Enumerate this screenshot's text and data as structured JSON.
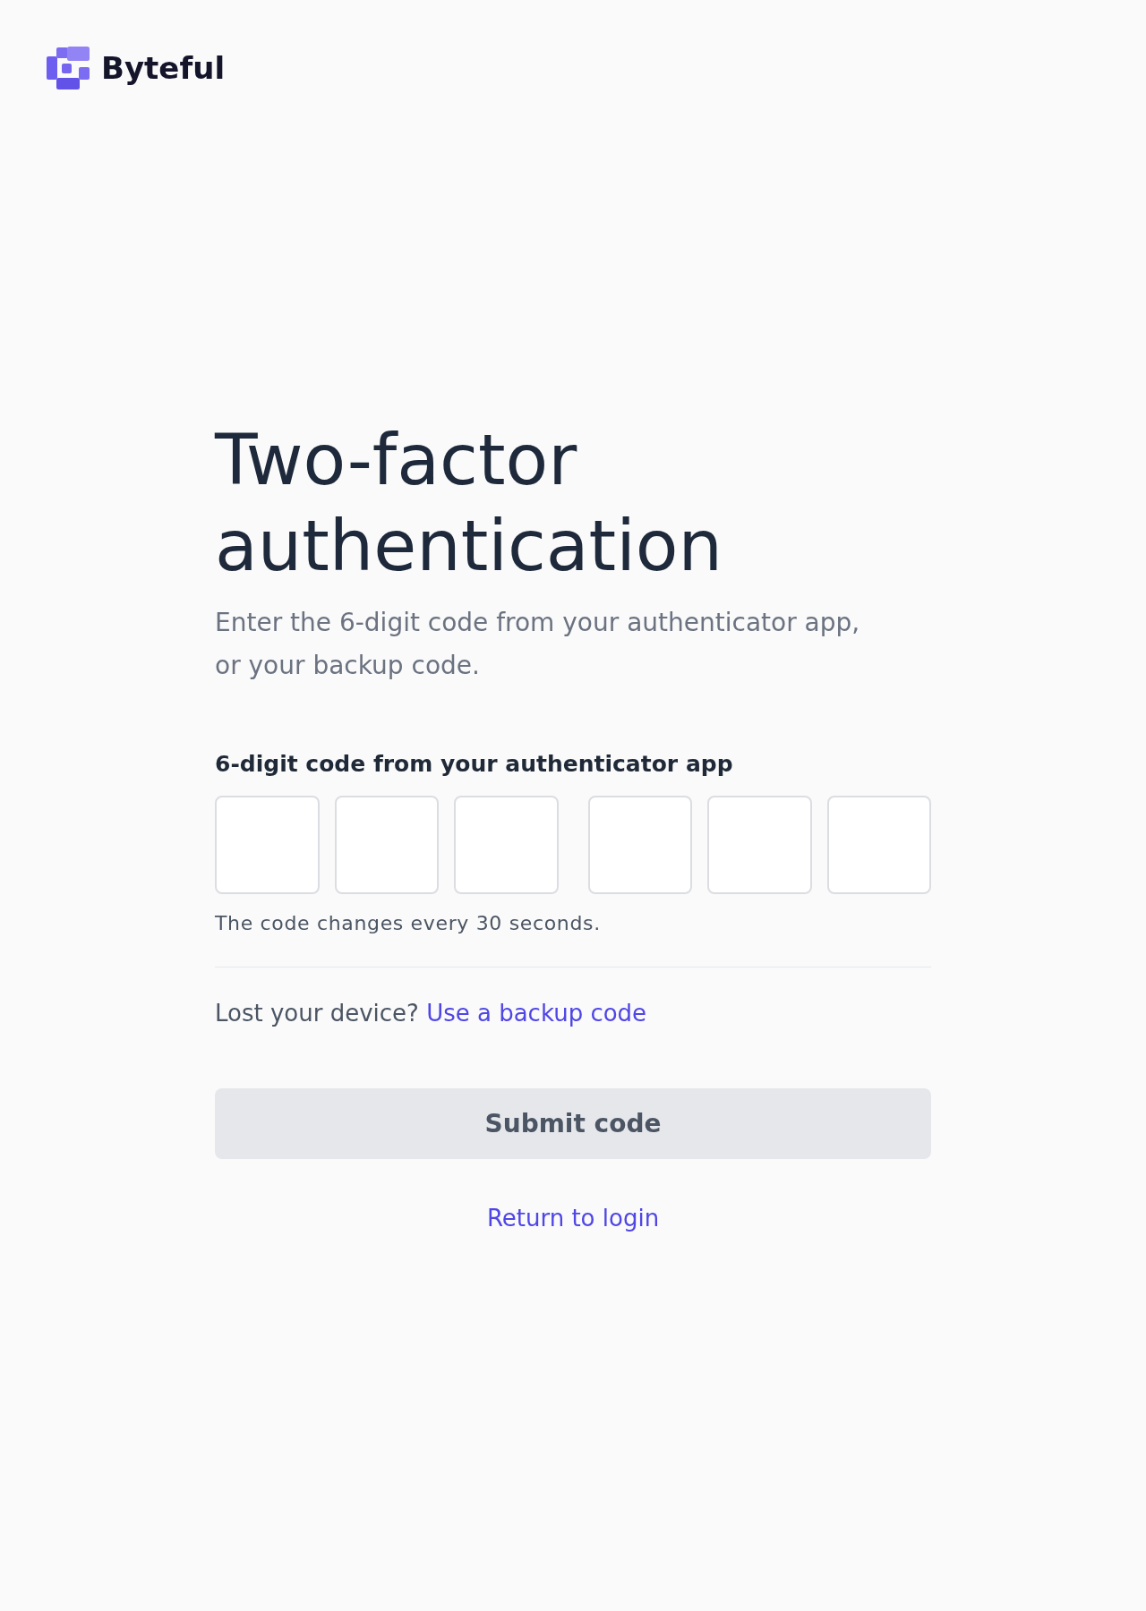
{
  "brand": {
    "name": "Byteful"
  },
  "heading": "Two-factor authentication",
  "subtitle": "Enter the 6-digit code from your authenticator app, or your backup code.",
  "code_field": {
    "label": "6-digit code from your authenticator app",
    "groups": [
      {
        "digits": [
          {
            "focused": false
          },
          {
            "focused": false
          },
          {
            "focused": false
          }
        ]
      },
      {
        "digits": [
          {
            "focused": false
          },
          {
            "focused": false
          },
          {
            "focused": false
          }
        ]
      }
    ],
    "hint": "The code changes every 30 seconds."
  },
  "backup": {
    "text": "Lost your device?",
    "link": "Use a backup code"
  },
  "submit_button": {
    "label": "Submit code",
    "disabled": true
  },
  "return_link": "Return to login"
}
